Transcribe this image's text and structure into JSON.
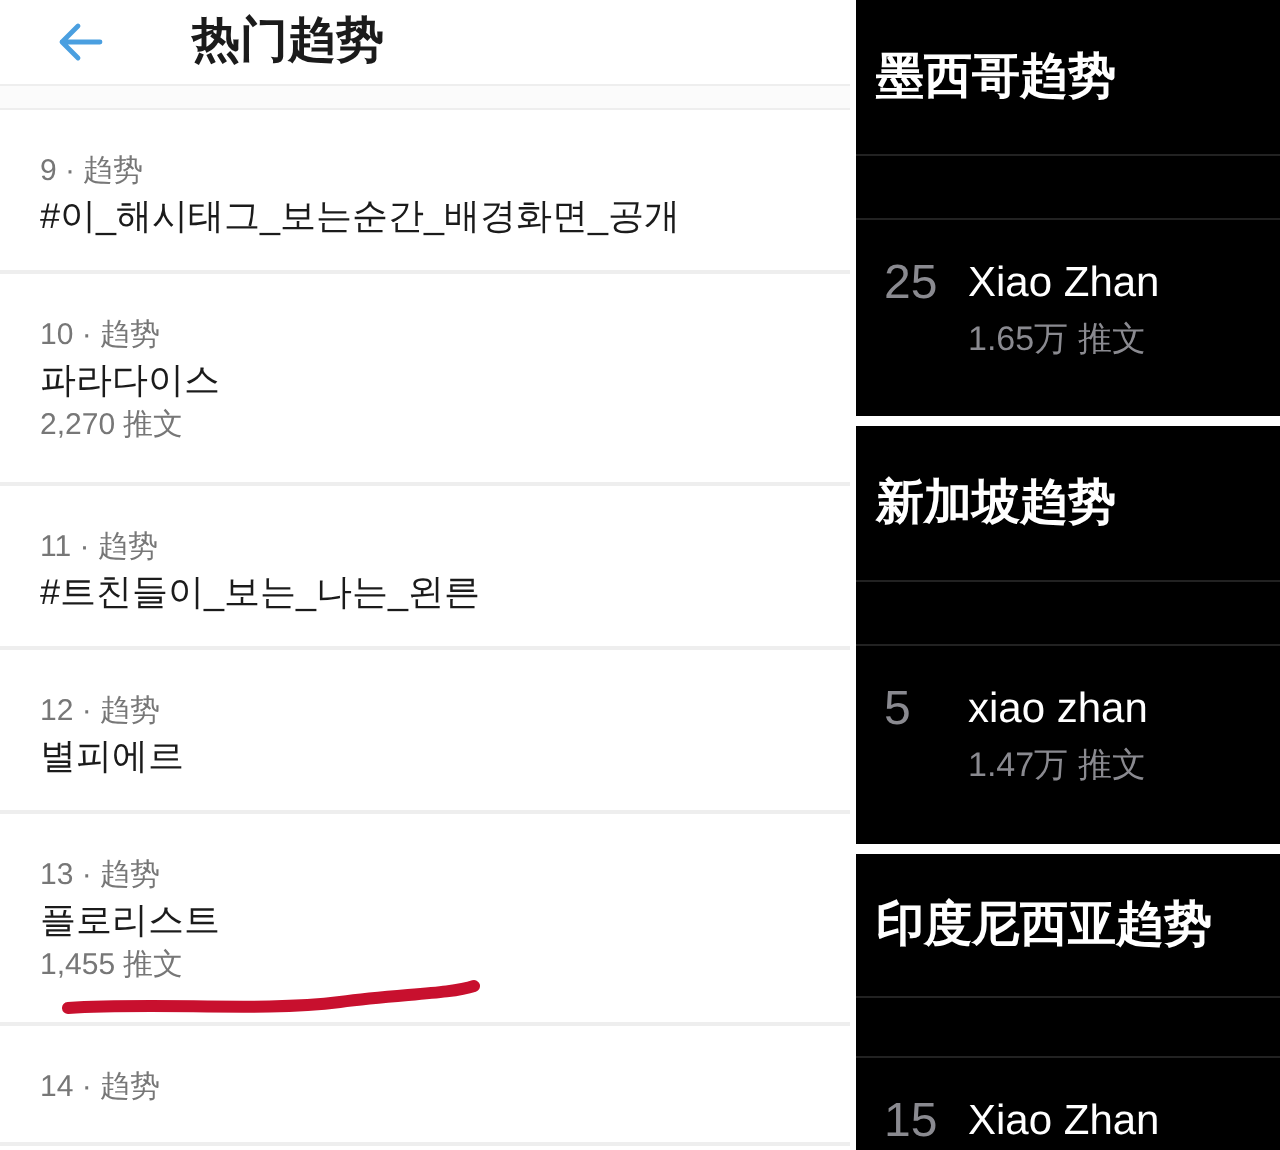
{
  "header": {
    "title": "热门趋势"
  },
  "trends": [
    {
      "meta": "9 · 趋势",
      "title": "#이_해시태그_보는순간_배경화면_공개",
      "underlined": false
    },
    {
      "meta": "10 · 趋势",
      "title": "파라다이스",
      "count": "2,270 推文",
      "underlined": false
    },
    {
      "meta": "11 · 趋势",
      "title": "#트친들이_보는_나는_왼른",
      "underlined": false
    },
    {
      "meta": "12 · 趋势",
      "title": "별피에르",
      "underlined": false
    },
    {
      "meta": "13 · 趋势",
      "title": "플로리스트",
      "count": "1,455 推文",
      "underlined": true
    },
    {
      "meta": "14 · 趋势",
      "underlined": false
    }
  ],
  "regions": [
    {
      "title": "墨西哥趋势",
      "rank": "25",
      "name": "Xiao Zhan",
      "count": "1.65万 推文"
    },
    {
      "title": "新加坡趋势",
      "rank": "5",
      "name": "xiao zhan",
      "count": "1.47万 推文"
    },
    {
      "title": "印度尼西亚趋势",
      "rank": "15",
      "name": "Xiao Zhan"
    }
  ]
}
